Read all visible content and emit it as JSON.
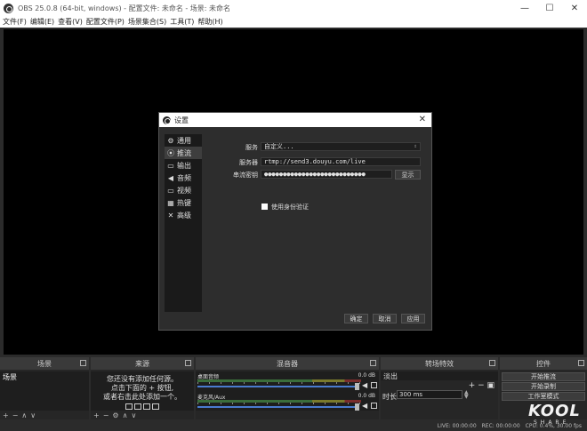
{
  "window": {
    "title": "OBS 25.0.8 (64-bit, windows) - 配置文件: 未命名 - 场景: 未命名",
    "min": "—",
    "max": "☐",
    "close": "✕"
  },
  "menu": [
    "文件(F)",
    "编辑(E)",
    "查看(V)",
    "配置文件(P)",
    "场景集合(S)",
    "工具(T)",
    "帮助(H)"
  ],
  "dialog": {
    "title": "设置",
    "close": "✕",
    "nav": [
      {
        "label": "通用",
        "icon": "gear-icon"
      },
      {
        "label": "推流",
        "icon": "broadcast-icon"
      },
      {
        "label": "输出",
        "icon": "output-icon"
      },
      {
        "label": "音频",
        "icon": "speaker-icon"
      },
      {
        "label": "视频",
        "icon": "monitor-icon"
      },
      {
        "label": "热键",
        "icon": "keyboard-icon"
      },
      {
        "label": "高级",
        "icon": "tools-icon"
      }
    ],
    "active_nav": 1,
    "service_label": "服务",
    "service_value": "自定义...",
    "server_label": "服务器",
    "server_value": "rtmp://send3.douyu.com/live",
    "key_label": "串流密钥",
    "key_value": "●●●●●●●●●●●●●●●●●●●●●●●●●●●",
    "show_button": "显示",
    "auth_checkbox_label": "使用身份验证",
    "auth_checked": false,
    "ok": "确定",
    "cancel": "取消",
    "apply": "应用"
  },
  "docks": {
    "scenes": {
      "title": "场景",
      "items": [
        "场景"
      ],
      "footer": [
        "+",
        "−",
        "∧",
        "∨"
      ]
    },
    "sources": {
      "title": "来源",
      "hint_lines": [
        "您还没有添加任何源。",
        "点击下面的 + 按钮,",
        "或者右击此处添加一个。"
      ],
      "footer": [
        "+",
        "−",
        "⚙",
        "∧",
        "∨"
      ]
    },
    "mixer": {
      "title": "混音器",
      "channels": [
        {
          "name": "桌面音频",
          "db": "0.0 dB"
        },
        {
          "name": "麦克风/Aux",
          "db": "0.0 dB"
        }
      ]
    },
    "transitions": {
      "title": "转场特效",
      "selected": "淡出",
      "plusminus": "+ − ▣",
      "duration_label": "时长",
      "duration_value": "300 ms"
    },
    "controls": {
      "title": "控件",
      "buttons": [
        "开始推流",
        "开始录制",
        "工作室模式"
      ]
    }
  },
  "status": {
    "live": "LIVE: 00:00:00",
    "rec": "REC: 00:00:00",
    "cpu": "CPU: 0.4%, 30.00 fps"
  },
  "watermark": {
    "big": "KOOL",
    "small": "SHARE"
  }
}
